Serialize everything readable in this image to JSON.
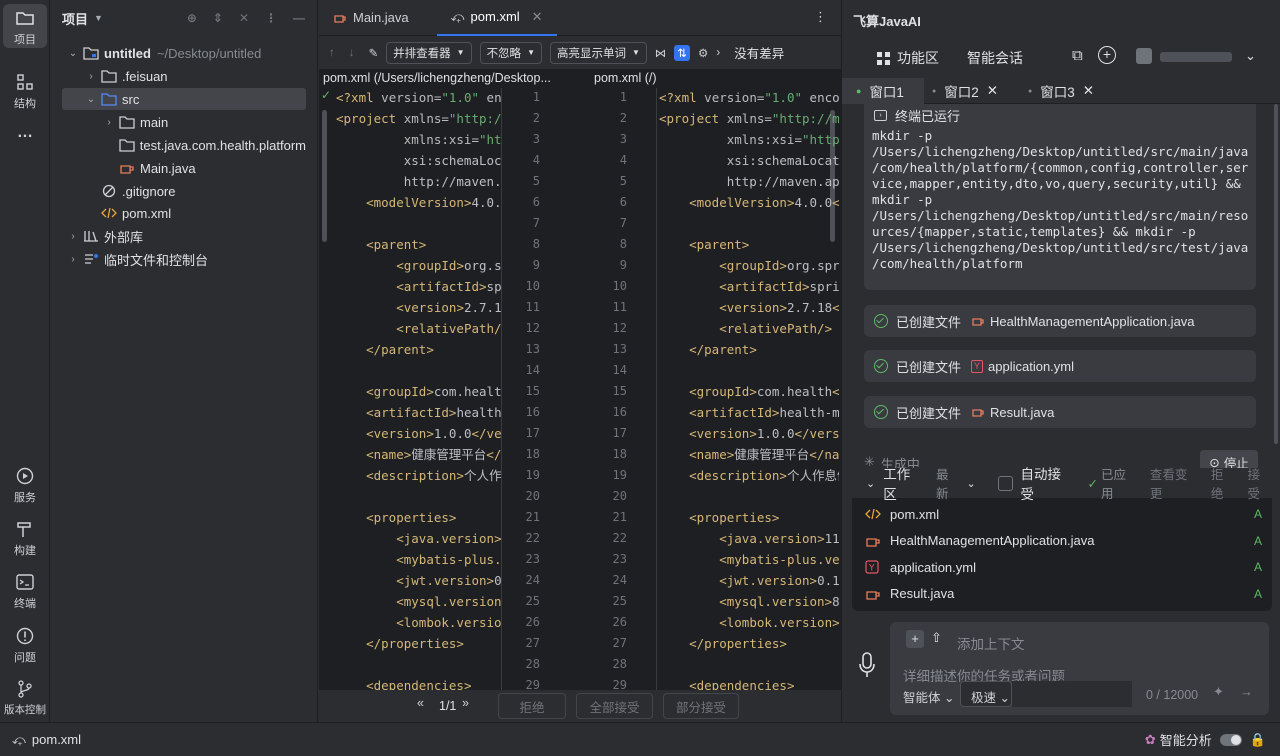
{
  "strip": {
    "top": [
      {
        "label": "项目",
        "icon": "folder-icon"
      },
      {
        "label": "结构",
        "icon": "structure-icon"
      },
      {
        "label": "…",
        "icon": "more-icon"
      }
    ],
    "bottom": [
      {
        "label": "服务",
        "icon": "services-icon"
      },
      {
        "label": "构建",
        "icon": "hammer-icon"
      },
      {
        "label": "终端",
        "icon": "terminal-icon"
      },
      {
        "label": "问题",
        "icon": "problems-icon"
      },
      {
        "label": "版本控制",
        "icon": "vcs-icon"
      }
    ]
  },
  "project": {
    "title": "项目",
    "tree": [
      {
        "label": "untitled",
        "suffix": "~/Desktop/untitled",
        "icon": "module-folder-icon",
        "expanded": true,
        "level": 0,
        "bold": true
      },
      {
        "label": ".feisuan",
        "icon": "folder-icon",
        "expanded": false,
        "level": 1
      },
      {
        "label": "src",
        "icon": "source-folder-icon",
        "expanded": true,
        "level": 1,
        "selected": true
      },
      {
        "label": "main",
        "icon": "folder-icon",
        "expanded": false,
        "level": 2
      },
      {
        "label": "test.java.com.health.platform",
        "icon": "folder-icon",
        "level": 2
      },
      {
        "label": "Main.java",
        "icon": "java-icon",
        "level": 2
      },
      {
        "label": ".gitignore",
        "icon": "ignore-icon",
        "level": 1
      },
      {
        "label": "pom.xml",
        "icon": "xml-icon",
        "level": 1
      },
      {
        "label": "外部库",
        "icon": "library-icon",
        "expanded": false,
        "level": 0
      },
      {
        "label": "临时文件和控制台",
        "icon": "scratch-icon",
        "expanded": false,
        "level": 0
      }
    ]
  },
  "editor": {
    "tabs": [
      {
        "label": "Main.java",
        "icon": "java-icon"
      },
      {
        "label": "pom.xml",
        "icon": "diff-icon",
        "active": true
      }
    ],
    "toolbar": {
      "viewer": "并排查看器",
      "ignore": "不忽略",
      "highlight": "高亮显示单词",
      "no_diff": "没有差异"
    },
    "left_path": "pom.xml (/Users/lichengzheng/Desktop...",
    "right_path": "pom.xml (/)",
    "left_lines": [
      "<?xml version=\"1.0\" en",
      "<project xmlns=\"http:/",
      "         xmlns:xsi=\"ht",
      "         xsi:schemaLoc",
      "         http://maven.",
      "    <modelVersion>4.0.",
      "",
      "    <parent>",
      "        <groupId>org.s",
      "        <artifactId>sp",
      "        <version>2.7.1",
      "        <relativePath/",
      "    </parent>",
      "",
      "    <groupId>com.healt",
      "    <artifactId>health",
      "    <version>1.0.0</ve",
      "    <name>健康管理平台</",
      "    <description>个人作",
      "",
      "    <properties>",
      "        <java.version>",
      "        <mybatis-plus.",
      "        <jwt.version>0",
      "        <mysql.version",
      "        <lombok.versio",
      "    </properties>",
      "",
      "    <dependencies>"
    ],
    "right_lines": [
      "<?xml version=\"1.0\" enco",
      "<project xmlns=\"http://ma",
      "         xmlns:xsi=\"http",
      "         xsi:schemaLocati",
      "         http://maven.apa",
      "    <modelVersion>4.0.0</",
      "",
      "    <parent>",
      "        <groupId>org.spri",
      "        <artifactId>sprin",
      "        <version>2.7.18</",
      "        <relativePath/>",
      "    </parent>",
      "",
      "    <groupId>com.health</",
      "    <artifactId>health-ma",
      "    <version>1.0.0</versi",
      "    <name>健康管理平台</nam",
      "    <description>个人作息健",
      "",
      "    <properties>",
      "        <java.version>11<",
      "        <mybatis-plus.ver",
      "        <jwt.version>0.12",
      "        <mysql.version>8",
      "        <lombok.version>1",
      "    </properties>",
      "",
      "    <dependencies>"
    ],
    "bottom": {
      "pager": "1/1",
      "reject": "拒绝",
      "accept_all": "全部接受",
      "accept_part": "部分接受"
    }
  },
  "ai": {
    "title": "飞算JavaAI",
    "nav": {
      "functions": "功能区",
      "chat": "智能会话"
    },
    "windows": [
      {
        "label": "窗口1",
        "active": true
      },
      {
        "label": "窗口2",
        "closable": true
      },
      {
        "label": "窗口3",
        "closable": true
      }
    ],
    "terminal_label": "终端已运行",
    "command": "mkdir -p\n/Users/lichengzheng/Desktop/untitled/src/main/java\n/com/health/platform/{common,config,controller,ser\nvice,mapper,entity,dto,vo,query,security,util} &&\nmkdir -p\n/Users/lichengzheng/Desktop/untitled/src/main/reso\nurces/{mapper,static,templates} && mkdir -p\n/Users/lichengzheng/Desktop/untitled/src/test/java\n/com/health/platform",
    "created_label": "已创建文件",
    "created_files": [
      {
        "name": "HealthManagementApplication.java",
        "icon": "java-icon"
      },
      {
        "name": "application.yml",
        "icon": "yaml-icon"
      },
      {
        "name": "Result.java",
        "icon": "java-icon"
      }
    ],
    "generating": "生成中",
    "stop": "停止",
    "workspace": {
      "title": "工作区",
      "filter": "最新",
      "auto_accept": "自动接受",
      "applied": "已应用",
      "view_changes": "查看变更",
      "reject": "拒绝",
      "accept": "接受",
      "files": [
        {
          "name": "pom.xml",
          "icon": "xml-icon",
          "status": "A"
        },
        {
          "name": "HealthManagementApplication.java",
          "icon": "java-icon",
          "status": "A"
        },
        {
          "name": "application.yml",
          "icon": "yaml-icon",
          "status": "A"
        },
        {
          "name": "Result.java",
          "icon": "java-icon",
          "status": "A"
        }
      ]
    },
    "input": {
      "add_context": "添加上下文",
      "placeholder": "详细描述你的任务或者问题",
      "mode": "智能体",
      "speed": "极速",
      "count": "0",
      "max": "12000"
    }
  },
  "status": {
    "branch": "pom.xml",
    "analysis": "智能分析"
  }
}
